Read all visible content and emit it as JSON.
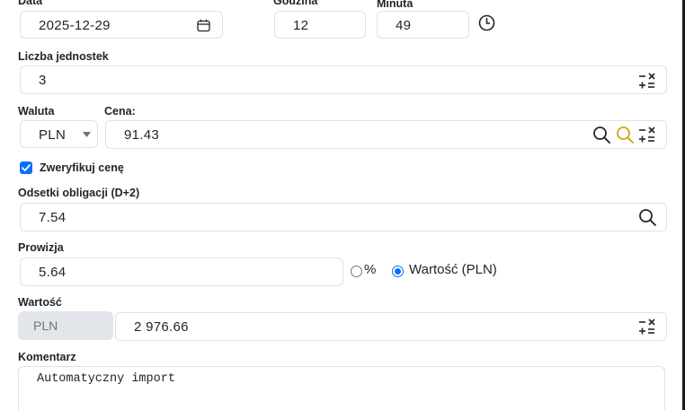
{
  "date": {
    "label": "Data",
    "value": "2025-12-29"
  },
  "hour": {
    "label": "Godzina",
    "value": "12"
  },
  "minute": {
    "label": "Minuta",
    "value": "49"
  },
  "units": {
    "label": "Liczba jednostek",
    "value": "3"
  },
  "currency": {
    "label": "Waluta",
    "value": "PLN"
  },
  "price": {
    "label": "Cena:",
    "value": "91.43"
  },
  "verify_price": {
    "label": "Zweryfikuj cenę",
    "checked": true
  },
  "bond_interest": {
    "label": "Odsetki obligacji (D+2)",
    "value": "7.54"
  },
  "commission": {
    "label": "Prowizja",
    "value": "5.64",
    "option_percent": "%",
    "option_value": "Wartość (PLN)",
    "selected": "value"
  },
  "total": {
    "label": "Wartość",
    "currency": "PLN",
    "value": "2 976.66"
  },
  "comment": {
    "label": "Komentarz",
    "value": "Automatyczny import"
  },
  "colors": {
    "accent": "#0d6efd",
    "search_highlight": "#d4a017",
    "disabled_bg": "#e2e6ea"
  },
  "icons": [
    "calendar-icon",
    "clock-icon",
    "calculator-icon",
    "search-icon",
    "search-highlight-icon",
    "caret-down-icon"
  ]
}
